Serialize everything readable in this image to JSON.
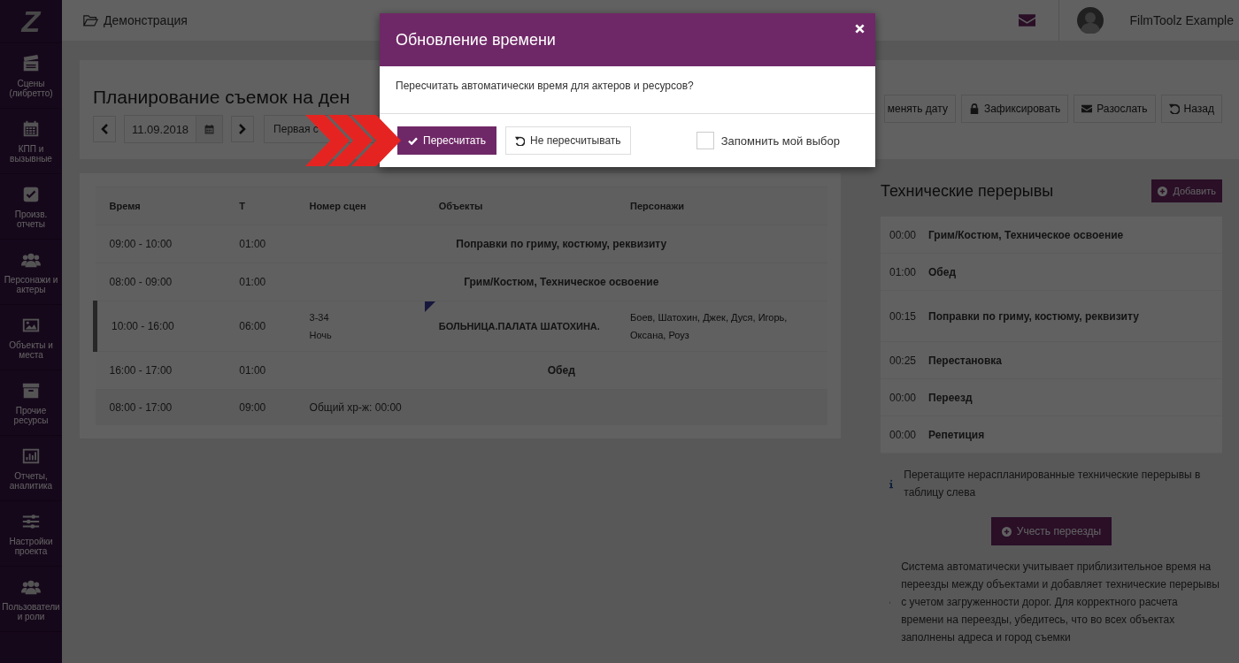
{
  "logo": {
    "text": "Z"
  },
  "sidebar": {
    "items": [
      {
        "label": "Сцены (либретто)"
      },
      {
        "label": "КПП и вызывные"
      },
      {
        "label": "Произв. отчеты"
      },
      {
        "label": "Персонажи и актеры"
      },
      {
        "label": "Объекты и места"
      },
      {
        "label": "Прочие ресурсы"
      },
      {
        "label": "Отчеты, аналитика"
      },
      {
        "label": "Настройки проекта"
      },
      {
        "label": "Пользователи и роли"
      }
    ]
  },
  "breadcrumb": "Демонстрация",
  "user": {
    "name": "FilmToolz Example"
  },
  "page": {
    "title": "Планирование съемок на ден",
    "date": "11.09.2018",
    "shift": "Первая с"
  },
  "toolbar": [
    {
      "label": "менять дату"
    },
    {
      "label": "Зафиксировать"
    },
    {
      "label": "Разослать"
    },
    {
      "label": "Назад"
    }
  ],
  "schedule": {
    "columns": [
      "Время",
      "Т",
      "Номер сцен",
      "Объекты",
      "Персонажи"
    ],
    "rows": [
      {
        "kind": "break",
        "time": "09:00 - 10:00",
        "duration": "01:00",
        "label": "Поправки по гриму, костюму, реквизиту"
      },
      {
        "kind": "break",
        "time": "08:00 - 09:00",
        "duration": "01:00",
        "label": "Грим/Костюм, Техническое освоение"
      },
      {
        "kind": "scene",
        "time": "10:00 - 16:00",
        "duration": "06:00",
        "scenes": [
          "3-34",
          "Ночь"
        ],
        "objects": "БОЛЬНИЦА.ПАЛАТА ШАТОХИНА.",
        "characters": "Боев, Шатохин, Джек, Дуся, Игорь, Оксана, Роуз"
      },
      {
        "kind": "break",
        "time": "16:00 - 17:00",
        "duration": "01:00",
        "label": "Обед"
      },
      {
        "kind": "total",
        "time": "08:00 - 17:00",
        "duration": "09:00",
        "note": "Общий хр-ж: 00:00"
      }
    ]
  },
  "tech_breaks": {
    "title": "Технические перерывы",
    "add_button": "Добавить",
    "items": [
      {
        "duration": "00:00",
        "name": "Грим/Костюм, Техническое освоение"
      },
      {
        "duration": "01:00",
        "name": "Обед"
      },
      {
        "duration": "00:15",
        "name": "Поправки по гриму, костюму, реквизиту"
      },
      {
        "duration": "00:25",
        "name": "Перестановка"
      },
      {
        "duration": "00:00",
        "name": "Переезд"
      },
      {
        "duration": "00:00",
        "name": "Репетиция"
      }
    ],
    "hint": "Перетащите нераспланированные технические перерывы в таблицу слева",
    "travel_button": "Учесть переезды",
    "note": "Система автоматически учитывает приблизительное время на переезды между объектами и добавляет технические перерывы с учетом загруженности дорог. Для корректного расчета времени на переезды, убедитесь, что во всех объектах заполнены адреса и город съемки"
  },
  "modal": {
    "title": "Обновление времени",
    "message": "Пересчитать автоматически время для актеров и ресурсов?",
    "confirm": "Пересчитать",
    "cancel": "Не пересчитывать",
    "remember": {
      "label": "Запомнить мой выбор",
      "checked": false
    }
  }
}
